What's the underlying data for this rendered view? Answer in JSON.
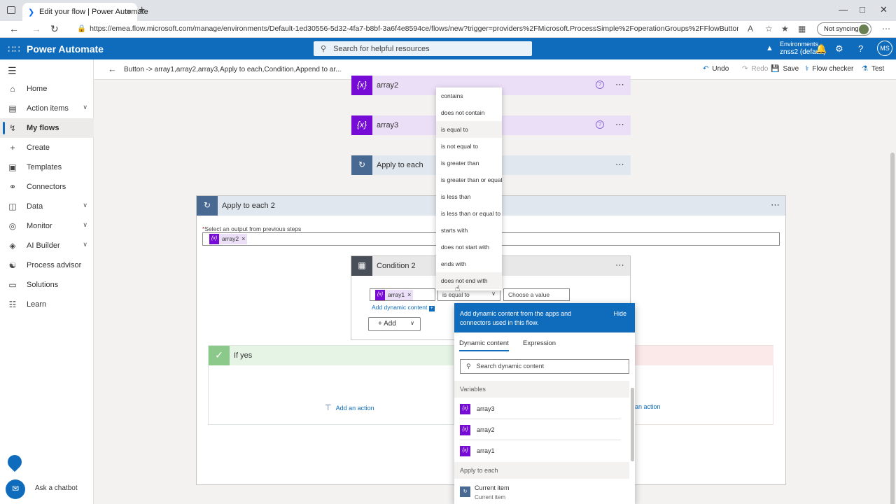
{
  "browser": {
    "tab_title": "Edit your flow | Power Automate",
    "url": "https://emea.flow.microsoft.com/manage/environments/Default-1ed30556-5d32-4fa7-b8bf-3a6f4e8594ce/flows/new?trigger=providers%2FMicrosoft.ProcessSimple%2FoperationGroups%2FFlowButton%2Foperations%2FFlowButt...",
    "sync_label": "Not syncing"
  },
  "header": {
    "app_name": "Power Automate",
    "search_placeholder": "Search for helpful resources",
    "env_label": "Environments",
    "env_value": "znss2 (default)",
    "avatar": "MS"
  },
  "sidebar": {
    "items": [
      {
        "label": "Home"
      },
      {
        "label": "Action items"
      },
      {
        "label": "My flows"
      },
      {
        "label": "Create"
      },
      {
        "label": "Templates"
      },
      {
        "label": "Connectors"
      },
      {
        "label": "Data"
      },
      {
        "label": "Monitor"
      },
      {
        "label": "AI Builder"
      },
      {
        "label": "Process advisor"
      },
      {
        "label": "Solutions"
      },
      {
        "label": "Learn"
      }
    ],
    "chatbot_label": "Ask a chatbot"
  },
  "cmdbar": {
    "breadcrumb": "Button -> array1,array2,array3,Apply to each,Condition,Append to ar...",
    "undo": "Undo",
    "redo": "Redo",
    "save": "Save",
    "checker": "Flow checker",
    "test": "Test"
  },
  "flow": {
    "array2_title": "array2",
    "array3_title": "array3",
    "apply_each_title": "Apply to each",
    "apply_each2_title": "Apply to each 2",
    "select_output_label": "Select an output from previous steps",
    "token_array2": "array2",
    "condition_title": "Condition 2",
    "token_array1": "array1",
    "operator_value": "is equal to",
    "choose_value_placeholder": "Choose a value",
    "add_dynamic_content": "Add dynamic content",
    "add_button": "Add",
    "if_yes": "If yes",
    "add_action": "Add an action",
    "add_action_no": "an action"
  },
  "operators": [
    "contains",
    "does not contain",
    "is equal to",
    "is not equal to",
    "is greater than",
    "is greater than or equal to",
    "is less than",
    "is less than or equal to",
    "starts with",
    "does not start with",
    "ends with",
    "does not end with"
  ],
  "dynamic_panel": {
    "header_text": "Add dynamic content from the apps and connectors used in this flow.",
    "hide": "Hide",
    "tab_dynamic": "Dynamic content",
    "tab_expression": "Expression",
    "search_placeholder": "Search dynamic content",
    "group_variables": "Variables",
    "variables": [
      "array3",
      "array2",
      "array1"
    ],
    "group_apply": "Apply to each",
    "current_item": "Current item",
    "current_item_sub": "Current item"
  },
  "colors": {
    "brand": "#0f6cbd",
    "variable": "#770bd6",
    "control": "#486991"
  }
}
